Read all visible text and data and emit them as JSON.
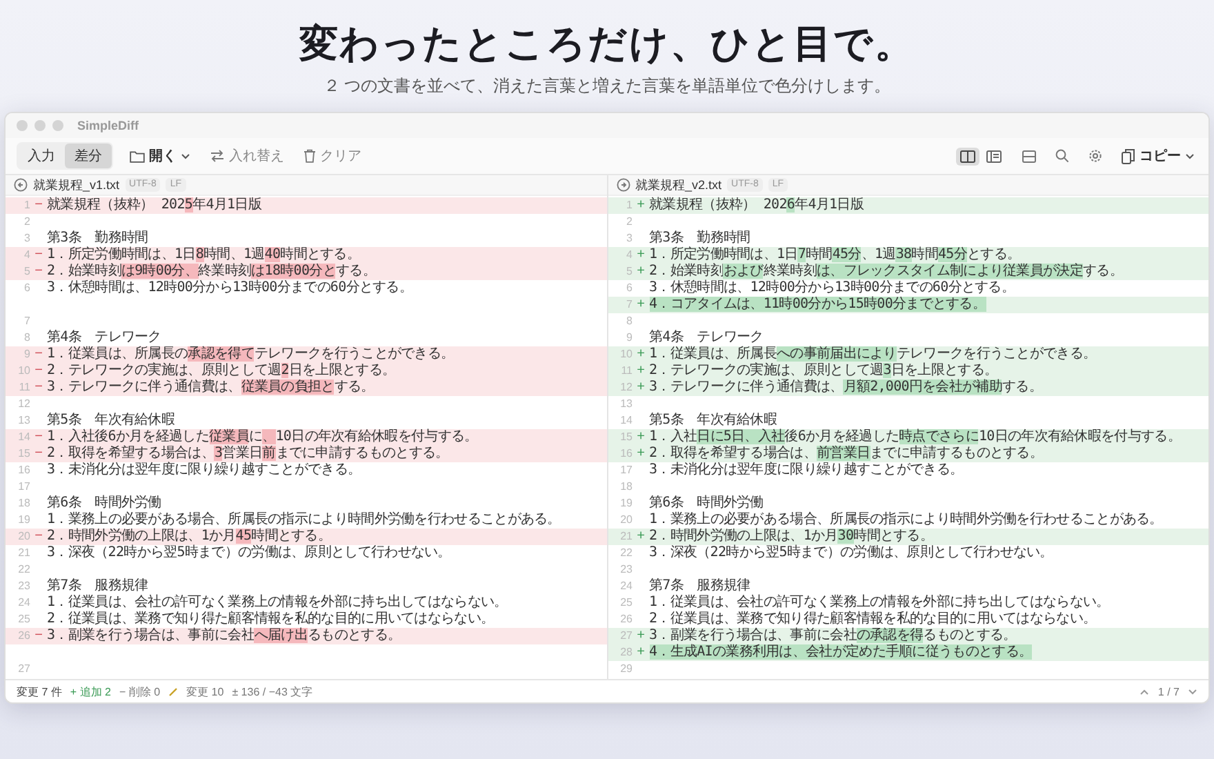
{
  "headline": "変わったところだけ、ひと目で。",
  "subheadline": "２ つの文書を並べて、消えた言葉と増えた言葉を単語単位で色分けします。",
  "window": {
    "title": "SimpleDiff"
  },
  "toolbar": {
    "modes": [
      {
        "label": "入力",
        "selected": false
      },
      {
        "label": "差分",
        "selected": true
      }
    ],
    "open": "開く",
    "swap": "入れ替え",
    "clear": "クリア",
    "views": [
      {
        "kind": "split",
        "selected": true
      },
      {
        "kind": "unified",
        "selected": false
      }
    ],
    "copy": "コピー"
  },
  "left_pane": {
    "file": "就業規程_v1.txt",
    "encoding": "UTF-8",
    "line_ending": "LF",
    "lines": [
      {
        "number": "1",
        "kind": "removed",
        "marker": "−",
        "parts": [
          {
            "text": "就業規程（抜粋） 202",
            "changed": false
          },
          {
            "text": "5",
            "changed": true
          },
          {
            "text": "年4月1日版",
            "changed": false
          }
        ]
      },
      {
        "number": "2",
        "kind": "same"
      },
      {
        "number": "3",
        "kind": "same",
        "parts": [
          {
            "text": "第3条　勤務時間",
            "changed": false
          }
        ]
      },
      {
        "number": "4",
        "kind": "removed",
        "marker": "−",
        "parts": [
          {
            "text": "1．所定労働時間は、1日",
            "changed": false
          },
          {
            "text": "8",
            "changed": true
          },
          {
            "text": "時間、1週",
            "changed": false
          },
          {
            "text": "40",
            "changed": true
          },
          {
            "text": "時間とする。",
            "changed": false
          }
        ]
      },
      {
        "number": "5",
        "kind": "removed",
        "marker": "−",
        "parts": [
          {
            "text": "2．始業時刻",
            "changed": false
          },
          {
            "text": "は9時00分、",
            "changed": true
          },
          {
            "text": "終業時刻",
            "changed": false
          },
          {
            "text": "は18時00分と",
            "changed": true
          },
          {
            "text": "する。",
            "changed": false
          }
        ]
      },
      {
        "number": "6",
        "kind": "same",
        "parts": [
          {
            "text": "3．休憩時間は、12時00分から13時00分までの60分とする。",
            "changed": false
          }
        ]
      },
      {
        "kind": "spacer"
      },
      {
        "number": "7",
        "kind": "same"
      },
      {
        "number": "8",
        "kind": "same",
        "parts": [
          {
            "text": "第4条　テレワーク",
            "changed": false
          }
        ]
      },
      {
        "number": "9",
        "kind": "removed",
        "marker": "−",
        "parts": [
          {
            "text": "1．従業員は、所属長の",
            "changed": false
          },
          {
            "text": "承認を得て",
            "changed": true
          },
          {
            "text": "テレワークを行うことができる。",
            "changed": false
          }
        ]
      },
      {
        "number": "10",
        "kind": "removed",
        "marker": "−",
        "parts": [
          {
            "text": "2．テレワークの実施は、原則として週",
            "changed": false
          },
          {
            "text": "2",
            "changed": true
          },
          {
            "text": "日を上限とする。",
            "changed": false
          }
        ]
      },
      {
        "number": "11",
        "kind": "removed",
        "marker": "−",
        "parts": [
          {
            "text": "3．テレワークに伴う通信費は、",
            "changed": false
          },
          {
            "text": "従業員の負担と",
            "changed": true
          },
          {
            "text": "する。",
            "changed": false
          }
        ]
      },
      {
        "number": "12",
        "kind": "same"
      },
      {
        "number": "13",
        "kind": "same",
        "parts": [
          {
            "text": "第5条　年次有給休暇",
            "changed": false
          }
        ]
      },
      {
        "number": "14",
        "kind": "removed",
        "marker": "−",
        "parts": [
          {
            "text": "1．入社後6か月を経過した",
            "changed": false
          },
          {
            "text": "従業員",
            "changed": true
          },
          {
            "text": "に",
            "changed": false
          },
          {
            "text": "、",
            "changed": true
          },
          {
            "text": "10日の年次有給休暇を付与する。",
            "changed": false
          }
        ]
      },
      {
        "number": "15",
        "kind": "removed",
        "marker": "−",
        "parts": [
          {
            "text": "2．取得を希望する場合は、",
            "changed": false
          },
          {
            "text": "3",
            "changed": true
          },
          {
            "text": "営業日",
            "changed": false
          },
          {
            "text": "前",
            "changed": true
          },
          {
            "text": "までに申請するものとする。",
            "changed": false
          }
        ]
      },
      {
        "number": "16",
        "kind": "same",
        "parts": [
          {
            "text": "3．未消化分は翌年度に限り繰り越すことができる。",
            "changed": false
          }
        ]
      },
      {
        "number": "17",
        "kind": "same"
      },
      {
        "number": "18",
        "kind": "same",
        "parts": [
          {
            "text": "第6条　時間外労働",
            "changed": false
          }
        ]
      },
      {
        "number": "19",
        "kind": "same",
        "parts": [
          {
            "text": "1．業務上の必要がある場合、所属長の指示により時間外労働を行わせることがある。",
            "changed": false
          }
        ]
      },
      {
        "number": "20",
        "kind": "removed",
        "marker": "−",
        "parts": [
          {
            "text": "2．時間外労働の上限は、1か月",
            "changed": false
          },
          {
            "text": "45",
            "changed": true
          },
          {
            "text": "時間とする。",
            "changed": false
          }
        ]
      },
      {
        "number": "21",
        "kind": "same",
        "parts": [
          {
            "text": "3．深夜（22時から翌5時まで）の労働は、原則として行わせない。",
            "changed": false
          }
        ]
      },
      {
        "number": "22",
        "kind": "same"
      },
      {
        "number": "23",
        "kind": "same",
        "parts": [
          {
            "text": "第7条　服務規律",
            "changed": false
          }
        ]
      },
      {
        "number": "24",
        "kind": "same",
        "parts": [
          {
            "text": "1．従業員は、会社の許可なく業務上の情報を外部に持ち出してはならない。",
            "changed": false
          }
        ]
      },
      {
        "number": "25",
        "kind": "same",
        "parts": [
          {
            "text": "2．従業員は、業務で知り得た顧客情報を私的な目的に用いてはならない。",
            "changed": false
          }
        ]
      },
      {
        "number": "26",
        "kind": "removed",
        "marker": "−",
        "parts": [
          {
            "text": "3．副業を行う場合は、事前に会社",
            "changed": false
          },
          {
            "text": "へ届け出",
            "changed": true
          },
          {
            "text": "るものとする。",
            "changed": false
          }
        ]
      },
      {
        "kind": "spacer"
      },
      {
        "number": "27",
        "kind": "same"
      }
    ]
  },
  "right_pane": {
    "file": "就業規程_v2.txt",
    "encoding": "UTF-8",
    "line_ending": "LF",
    "lines": [
      {
        "number": "1",
        "kind": "added",
        "marker": "+",
        "parts": [
          {
            "text": "就業規程（抜粋） 202",
            "changed": false
          },
          {
            "text": "6",
            "changed": true
          },
          {
            "text": "年4月1日版",
            "changed": false
          }
        ]
      },
      {
        "number": "2",
        "kind": "same"
      },
      {
        "number": "3",
        "kind": "same",
        "parts": [
          {
            "text": "第3条　勤務時間",
            "changed": false
          }
        ]
      },
      {
        "number": "4",
        "kind": "added",
        "marker": "+",
        "parts": [
          {
            "text": "1．所定労働時間は、1日",
            "changed": false
          },
          {
            "text": "7",
            "changed": true
          },
          {
            "text": "時間",
            "changed": false
          },
          {
            "text": "45分",
            "changed": true
          },
          {
            "text": "、1週",
            "changed": false
          },
          {
            "text": "38",
            "changed": true
          },
          {
            "text": "時間",
            "changed": false
          },
          {
            "text": "45分",
            "changed": true
          },
          {
            "text": "とする。",
            "changed": false
          }
        ]
      },
      {
        "number": "5",
        "kind": "added",
        "marker": "+",
        "parts": [
          {
            "text": "2．始業時刻",
            "changed": false
          },
          {
            "text": "および",
            "changed": true
          },
          {
            "text": "終業時刻",
            "changed": false
          },
          {
            "text": "は、フレックスタイム制により従業員が決定",
            "changed": true
          },
          {
            "text": "する。",
            "changed": false
          }
        ]
      },
      {
        "number": "6",
        "kind": "same",
        "parts": [
          {
            "text": "3．休憩時間は、12時00分から13時00分までの60分とする。",
            "changed": false
          }
        ]
      },
      {
        "number": "7",
        "kind": "added",
        "marker": "+",
        "parts": [
          {
            "text": "4．コアタイムは、11時00分から15時00分までとする。",
            "changed": true
          }
        ]
      },
      {
        "number": "8",
        "kind": "same"
      },
      {
        "number": "9",
        "kind": "same",
        "parts": [
          {
            "text": "第4条　テレワーク",
            "changed": false
          }
        ]
      },
      {
        "number": "10",
        "kind": "added",
        "marker": "+",
        "parts": [
          {
            "text": "1．従業員は、所属長",
            "changed": false
          },
          {
            "text": "への事前届出により",
            "changed": true
          },
          {
            "text": "テレワークを行うことができる。",
            "changed": false
          }
        ]
      },
      {
        "number": "11",
        "kind": "added",
        "marker": "+",
        "parts": [
          {
            "text": "2．テレワークの実施は、原則として週",
            "changed": false
          },
          {
            "text": "3",
            "changed": true
          },
          {
            "text": "日を上限とする。",
            "changed": false
          }
        ]
      },
      {
        "number": "12",
        "kind": "added",
        "marker": "+",
        "parts": [
          {
            "text": "3．テレワークに伴う通信費は、",
            "changed": false
          },
          {
            "text": "月額2,000円を会社が補助",
            "changed": true
          },
          {
            "text": "する。",
            "changed": false
          }
        ]
      },
      {
        "number": "13",
        "kind": "same"
      },
      {
        "number": "14",
        "kind": "same",
        "parts": [
          {
            "text": "第5条　年次有給休暇",
            "changed": false
          }
        ]
      },
      {
        "number": "15",
        "kind": "added",
        "marker": "+",
        "parts": [
          {
            "text": "1．入社",
            "changed": false
          },
          {
            "text": "日に5日、入社",
            "changed": true
          },
          {
            "text": "後6か月を経過した",
            "changed": false
          },
          {
            "text": "時点でさらに",
            "changed": true
          },
          {
            "text": "10日の年次有給休暇を付与する。",
            "changed": false
          }
        ]
      },
      {
        "number": "16",
        "kind": "added",
        "marker": "+",
        "parts": [
          {
            "text": "2．取得を希望する場合は、",
            "changed": false
          },
          {
            "text": "前営業日",
            "changed": true
          },
          {
            "text": "までに申請するものとする。",
            "changed": false
          }
        ]
      },
      {
        "number": "17",
        "kind": "same",
        "parts": [
          {
            "text": "3．未消化分は翌年度に限り繰り越すことができる。",
            "changed": false
          }
        ]
      },
      {
        "number": "18",
        "kind": "same"
      },
      {
        "number": "19",
        "kind": "same",
        "parts": [
          {
            "text": "第6条　時間外労働",
            "changed": false
          }
        ]
      },
      {
        "number": "20",
        "kind": "same",
        "parts": [
          {
            "text": "1．業務上の必要がある場合、所属長の指示により時間外労働を行わせることがある。",
            "changed": false
          }
        ]
      },
      {
        "number": "21",
        "kind": "added",
        "marker": "+",
        "parts": [
          {
            "text": "2．時間外労働の上限は、1か月",
            "changed": false
          },
          {
            "text": "30",
            "changed": true
          },
          {
            "text": "時間とする。",
            "changed": false
          }
        ]
      },
      {
        "number": "22",
        "kind": "same",
        "parts": [
          {
            "text": "3．深夜（22時から翌5時まで）の労働は、原則として行わせない。",
            "changed": false
          }
        ]
      },
      {
        "number": "23",
        "kind": "same"
      },
      {
        "number": "24",
        "kind": "same",
        "parts": [
          {
            "text": "第7条　服務規律",
            "changed": false
          }
        ]
      },
      {
        "number": "25",
        "kind": "same",
        "parts": [
          {
            "text": "1．従業員は、会社の許可なく業務上の情報を外部に持ち出してはならない。",
            "changed": false
          }
        ]
      },
      {
        "number": "26",
        "kind": "same",
        "parts": [
          {
            "text": "2．従業員は、業務で知り得た顧客情報を私的な目的に用いてはならない。",
            "changed": false
          }
        ]
      },
      {
        "number": "27",
        "kind": "added",
        "marker": "+",
        "parts": [
          {
            "text": "3．副業を行う場合は、事前に会社",
            "changed": false
          },
          {
            "text": "の承認を得",
            "changed": true
          },
          {
            "text": "るものとする。",
            "changed": false
          }
        ]
      },
      {
        "number": "28",
        "kind": "added",
        "marker": "+",
        "parts": [
          {
            "text": "4．生成AIの業務利用は、会社が定めた手順に従うものとする。",
            "changed": true
          }
        ]
      },
      {
        "number": "29",
        "kind": "same"
      }
    ]
  },
  "status_bar": {
    "changes": "変更 7 件",
    "added": "+ 追加 2",
    "removed": "− 削除 0",
    "modified": "変更 10",
    "chars": "± 136 / −43 文字",
    "position": "1 / 7"
  }
}
